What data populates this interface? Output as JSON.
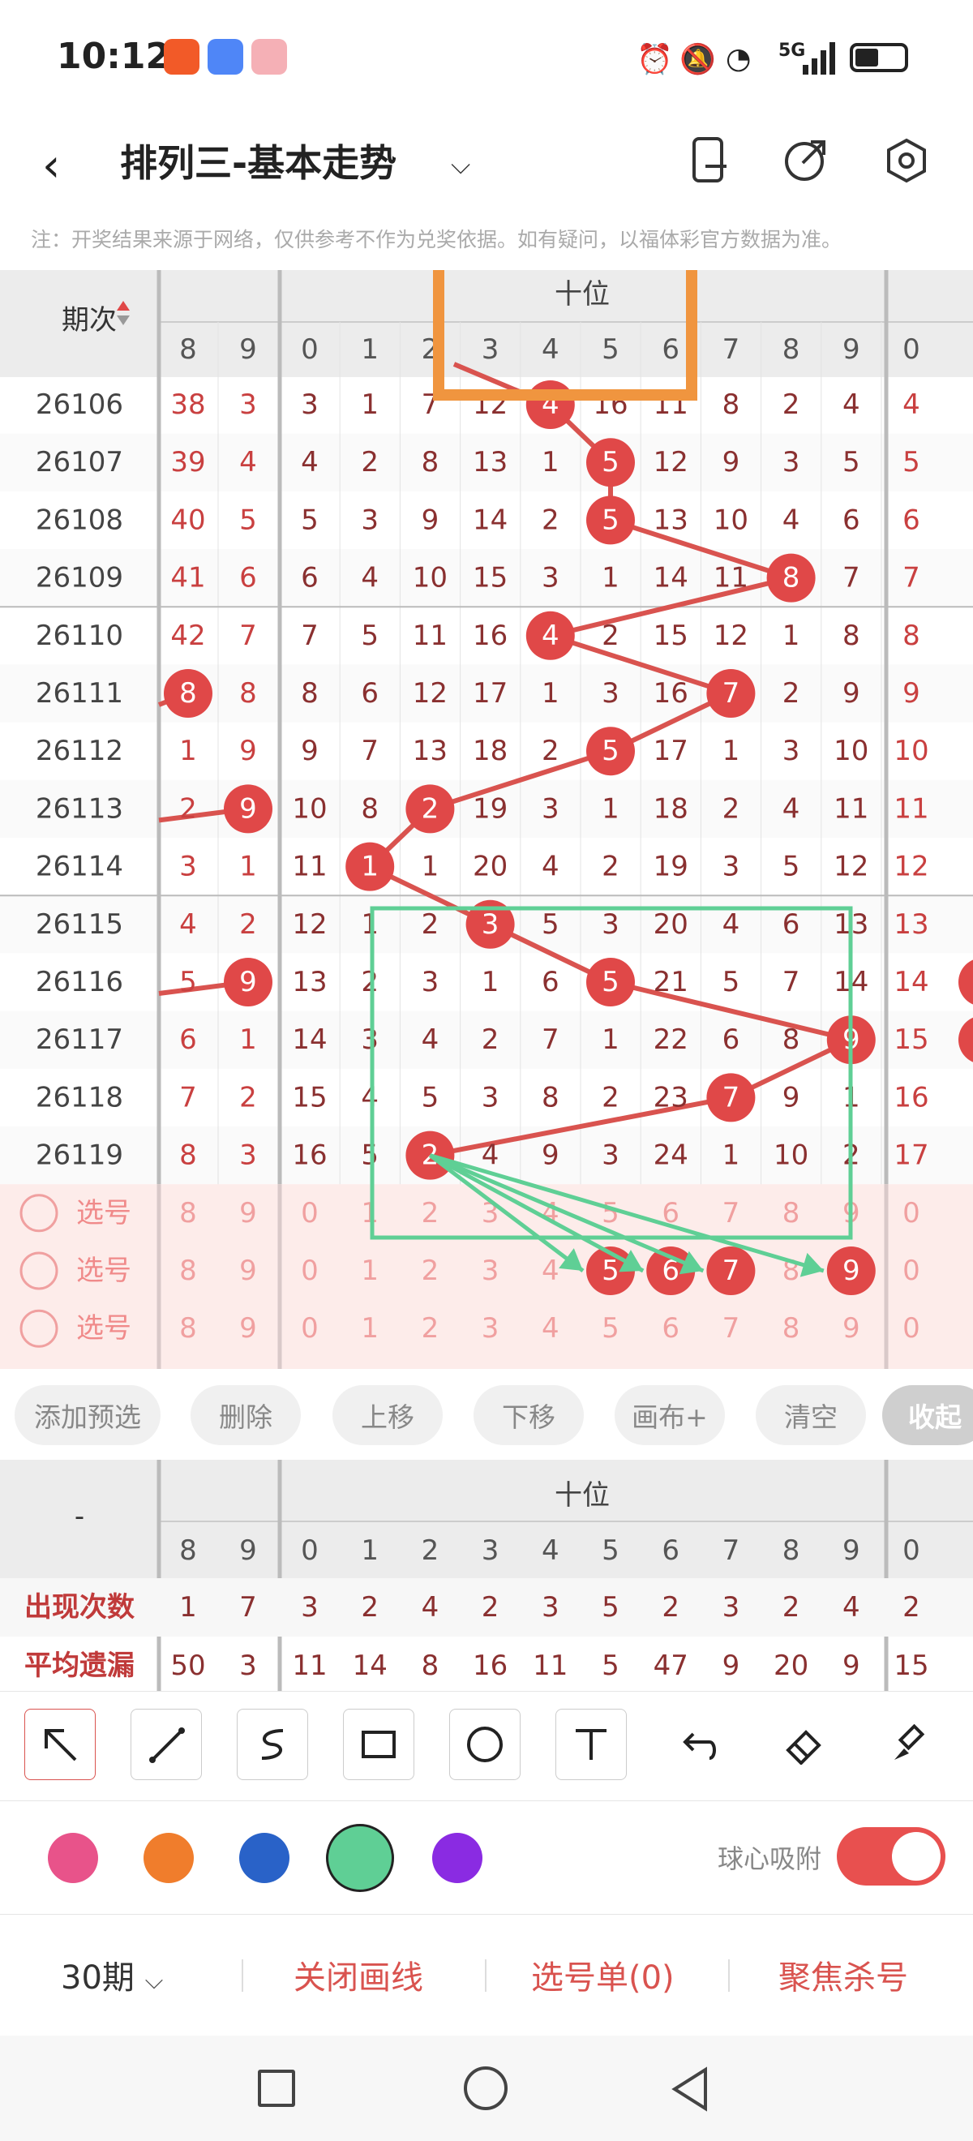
{
  "status_bar": {
    "time": "10:12",
    "network": "5G"
  },
  "header": {
    "title": "排列三-基本走势"
  },
  "notice": "注：开奖结果来源于网络，仅供参考不作为兑奖依据。如有疑问，以福体彩官方数据为准。",
  "grid": {
    "period_header": "期次",
    "group_label": "十位",
    "left_digits": [
      "8",
      "9"
    ],
    "digits": [
      "0",
      "1",
      "2",
      "3",
      "4",
      "5",
      "6",
      "7",
      "8",
      "9"
    ],
    "right_digit": "0",
    "rows": [
      {
        "period": "26106",
        "left": [
          "38",
          "3"
        ],
        "cells": [
          "3",
          "1",
          "7",
          "12",
          "4",
          "16",
          "11",
          "8",
          "2",
          "4"
        ],
        "right": "4",
        "hit": 4
      },
      {
        "period": "26107",
        "left": [
          "39",
          "4"
        ],
        "cells": [
          "4",
          "2",
          "8",
          "13",
          "1",
          "5",
          "12",
          "9",
          "3",
          "5"
        ],
        "right": "5",
        "hit": 5
      },
      {
        "period": "26108",
        "left": [
          "40",
          "5"
        ],
        "cells": [
          "5",
          "3",
          "9",
          "14",
          "2",
          "5",
          "13",
          "10",
          "4",
          "6"
        ],
        "right": "6",
        "hit": 5
      },
      {
        "period": "26109",
        "left": [
          "41",
          "6"
        ],
        "cells": [
          "6",
          "4",
          "10",
          "15",
          "3",
          "1",
          "14",
          "11",
          "8",
          "7"
        ],
        "right": "7",
        "hit": 8
      },
      {
        "period": "26110",
        "left": [
          "42",
          "7"
        ],
        "cells": [
          "7",
          "5",
          "11",
          "16",
          "4",
          "2",
          "15",
          "12",
          "1",
          "8"
        ],
        "right": "8",
        "hit": 4
      },
      {
        "period": "26111",
        "left": [
          "8",
          "8"
        ],
        "cells": [
          "8",
          "6",
          "12",
          "17",
          "1",
          "3",
          "16",
          "7",
          "2",
          "9"
        ],
        "right": "9",
        "hit": 7,
        "lhit": 0
      },
      {
        "period": "26112",
        "left": [
          "1",
          "9"
        ],
        "cells": [
          "9",
          "7",
          "13",
          "18",
          "2",
          "5",
          "17",
          "1",
          "3",
          "10"
        ],
        "right": "10",
        "hit": 5
      },
      {
        "period": "26113",
        "left": [
          "2",
          "9"
        ],
        "cells": [
          "10",
          "8",
          "2",
          "19",
          "3",
          "1",
          "18",
          "2",
          "4",
          "11"
        ],
        "right": "11",
        "hit": 2,
        "lhit": 1
      },
      {
        "period": "26114",
        "left": [
          "3",
          "1"
        ],
        "cells": [
          "11",
          "1",
          "1",
          "20",
          "4",
          "2",
          "19",
          "3",
          "5",
          "12"
        ],
        "right": "12",
        "hit": 1
      },
      {
        "period": "26115",
        "left": [
          "4",
          "2"
        ],
        "cells": [
          "12",
          "1",
          "2",
          "3",
          "5",
          "3",
          "20",
          "4",
          "6",
          "13"
        ],
        "right": "13",
        "hit": 3
      },
      {
        "period": "26116",
        "left": [
          "5",
          "9"
        ],
        "cells": [
          "13",
          "2",
          "3",
          "1",
          "6",
          "5",
          "21",
          "5",
          "7",
          "14"
        ],
        "right": "14",
        "hit": 5,
        "lhit": 1
      },
      {
        "period": "26117",
        "left": [
          "6",
          "1"
        ],
        "cells": [
          "14",
          "3",
          "4",
          "2",
          "7",
          "1",
          "22",
          "6",
          "8",
          "9"
        ],
        "right": "15",
        "hit": 9
      },
      {
        "period": "26118",
        "left": [
          "7",
          "2"
        ],
        "cells": [
          "15",
          "4",
          "5",
          "3",
          "8",
          "2",
          "23",
          "7",
          "9",
          "1"
        ],
        "right": "16",
        "hit": 7
      },
      {
        "period": "26119",
        "left": [
          "8",
          "3"
        ],
        "cells": [
          "16",
          "5",
          "2",
          "4",
          "9",
          "3",
          "24",
          "1",
          "10",
          "2"
        ],
        "right": "17",
        "hit": 2
      }
    ],
    "pick_label": "选号",
    "pick_rows": [
      {
        "left": [
          "8",
          "9"
        ],
        "cells": [
          "0",
          "1",
          "2",
          "3",
          "4",
          "5",
          "6",
          "7",
          "8",
          "9"
        ],
        "right": "0",
        "selected": []
      },
      {
        "left": [
          "8",
          "9"
        ],
        "cells": [
          "0",
          "1",
          "2",
          "3",
          "4",
          "5",
          "6",
          "7",
          "8",
          "9"
        ],
        "right": "0",
        "selected": [
          5,
          6,
          7,
          9
        ]
      },
      {
        "left": [
          "8",
          "9"
        ],
        "cells": [
          "0",
          "1",
          "2",
          "3",
          "4",
          "5",
          "6",
          "7",
          "8",
          "9"
        ],
        "right": "0",
        "selected": []
      }
    ]
  },
  "buttons": [
    "添加预选",
    "删除",
    "上移",
    "下移",
    "画布+",
    "清空",
    "收起"
  ],
  "stats": {
    "corner": "-",
    "group_label": "十位",
    "left_digits": [
      "8",
      "9"
    ],
    "digits": [
      "0",
      "1",
      "2",
      "3",
      "4",
      "5",
      "6",
      "7",
      "8",
      "9"
    ],
    "right_digit": "0",
    "rows": [
      {
        "label": "出现次数",
        "left": [
          "1",
          "7"
        ],
        "cells": [
          "3",
          "2",
          "4",
          "2",
          "3",
          "5",
          "2",
          "3",
          "2",
          "4"
        ],
        "right": "2"
      },
      {
        "label": "平均遗漏",
        "left": [
          "50",
          "3"
        ],
        "cells": [
          "11",
          "14",
          "8",
          "16",
          "11",
          "5",
          "47",
          "9",
          "20",
          "9"
        ],
        "right": "15"
      }
    ]
  },
  "tools": [
    "arrow-tool-icon",
    "line-tool-icon",
    "curve-tool-icon",
    "rectangle-tool-icon",
    "circle-tool-icon",
    "text-tool-icon",
    "undo-icon",
    "eraser-icon",
    "brush-icon"
  ],
  "palette": [
    "#e8538a",
    "#f07d2c",
    "#2962c8",
    "#5fcf95",
    "#8a2be2"
  ],
  "palette_selected": 3,
  "snap_label": "球心吸附",
  "snap_on": true,
  "bottom": {
    "period_select": "30期",
    "close_lines": "关闭画线",
    "pick_list": "选号单(0)",
    "focus_kill": "聚焦杀号"
  },
  "colors": {
    "red": "#e04848",
    "line_red": "#d9534f",
    "grey_text": "#555",
    "pink_bg": "#fdecea",
    "header_bg": "#ececec"
  }
}
